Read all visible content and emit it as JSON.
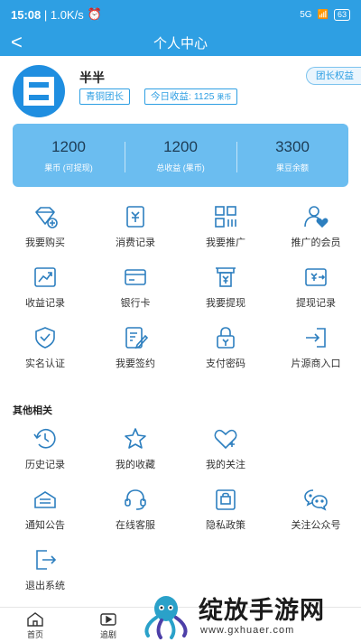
{
  "status_bar": {
    "time": "15:08",
    "speed": "1.0K/s",
    "signal": "5G",
    "battery": "63"
  },
  "header": {
    "title": "个人中心"
  },
  "profile": {
    "name": "半半",
    "level_tag": "青铜团长",
    "income_label": "今日收益: 1125",
    "income_unit": "果币",
    "leader_button": "团长权益"
  },
  "stats": [
    {
      "value": "1200",
      "label": "果币 (可提现)"
    },
    {
      "value": "1200",
      "label": "总收益 (果币)"
    },
    {
      "value": "3300",
      "label": "果豆余额"
    }
  ],
  "menu": [
    {
      "label": "我要购买",
      "icon": "diamond-add-icon"
    },
    {
      "label": "消费记录",
      "icon": "receipt-icon"
    },
    {
      "label": "我要推广",
      "icon": "qr-grid-icon"
    },
    {
      "label": "推广的会员",
      "icon": "user-heart-icon"
    },
    {
      "label": "收益记录",
      "icon": "chart-trend-icon"
    },
    {
      "label": "银行卡",
      "icon": "bank-card-icon"
    },
    {
      "label": "我要提现",
      "icon": "atm-icon"
    },
    {
      "label": "提现记录",
      "icon": "withdraw-record-icon"
    },
    {
      "label": "实名认证",
      "icon": "shield-check-icon"
    },
    {
      "label": "我要签约",
      "icon": "sign-document-icon"
    },
    {
      "label": "支付密码",
      "icon": "lock-icon"
    },
    {
      "label": "片源商入口",
      "icon": "enter-door-icon"
    }
  ],
  "other_section": {
    "title": "其他相关",
    "items": [
      {
        "label": "历史记录",
        "icon": "history-icon"
      },
      {
        "label": "我的收藏",
        "icon": "star-icon"
      },
      {
        "label": "我的关注",
        "icon": "heart-add-icon"
      },
      {
        "label": "通知公告",
        "icon": "notice-icon"
      },
      {
        "label": "在线客服",
        "icon": "headset-icon"
      },
      {
        "label": "隐私政策",
        "icon": "privacy-icon"
      },
      {
        "label": "关注公众号",
        "icon": "chat-bubbles-icon"
      },
      {
        "label": "退出系统",
        "icon": "logout-icon"
      }
    ]
  },
  "tabs": [
    {
      "label": "首页",
      "icon": "home-icon"
    },
    {
      "label": "追剧",
      "icon": "play-icon"
    }
  ],
  "watermark": {
    "text": "绽放手游网",
    "url": "www.gxhuaer.com"
  },
  "colors": {
    "primary": "#2e9fe3",
    "card": "#6bbdf0",
    "icon": "#2d7fbf"
  }
}
